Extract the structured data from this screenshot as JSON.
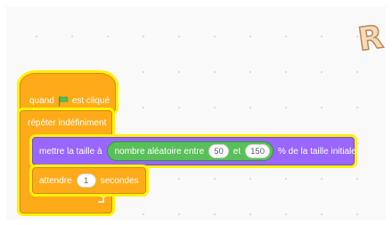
{
  "hat_block": {
    "label_when": "quand",
    "flag_icon": "green-flag-icon",
    "label_clicked": "est cliqué"
  },
  "forever_block": {
    "label": "répéter indéfiniment",
    "loop_icon": "loop-arrow-icon"
  },
  "set_size_block": {
    "label_prefix": "mettre la taille à",
    "label_suffix": "% de la taille initiale",
    "random_reporter": {
      "label_prefix": "nombre aléatoire entre",
      "from": "50",
      "label_and": "et",
      "to": "150"
    }
  },
  "wait_block": {
    "label_prefix": "attendre",
    "value": "1",
    "label_suffix": "secondes"
  },
  "sprite": {
    "glyph": "R"
  },
  "colors": {
    "events": "#ffab19",
    "looks": "#9966ff",
    "operators": "#59c059",
    "highlight": "#fff200"
  }
}
